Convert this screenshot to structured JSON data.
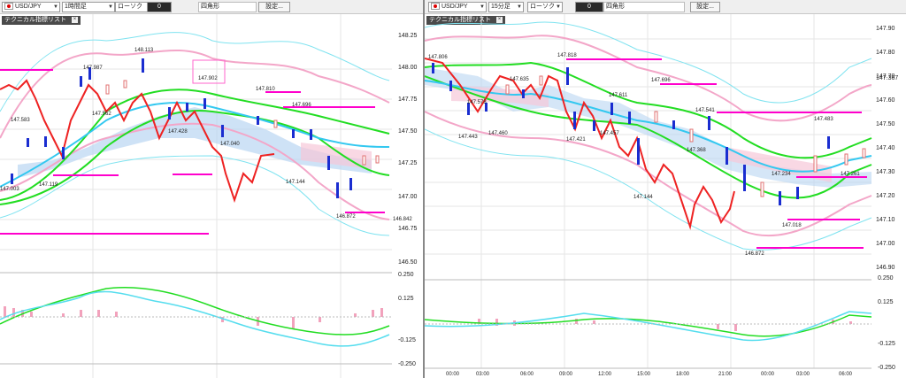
{
  "left_chart": {
    "symbol": "USD/JPY",
    "timeframe": "1時間足",
    "chart_type": "ローソク",
    "selected": "0",
    "shape": "四角形",
    "settings_label": "設定...",
    "tech_list_label": "テクニカル指標リスト",
    "price_ticks": [
      "148.25",
      "148.00",
      "147.75",
      "147.50",
      "147.25",
      "147.00",
      "146.75",
      "146.50"
    ],
    "osc_ticks": [
      "0.250",
      "0.125",
      "-0.125",
      "-0.250"
    ],
    "annotations": [
      "148.113",
      "147.987",
      "147.902",
      "147.583",
      "147.562",
      "147.810",
      "147.696",
      "147.119",
      "147.144",
      "146.842",
      "146.872",
      "147.428",
      "147.040",
      "147.003"
    ]
  },
  "right_chart": {
    "symbol": "USD/JPY",
    "timeframe": "15分足",
    "chart_type": "ローソク",
    "selected": "0",
    "shape": "四角形",
    "settings_label": "設定...",
    "tech_list_label": "テクニカル指標リスト",
    "price_ticks": [
      "147.90",
      "147.80",
      "147.70",
      "147.60",
      "147.50",
      "147.40",
      "147.30",
      "147.20",
      "147.10",
      "147.00",
      "146.90"
    ],
    "current_price": "147.367",
    "osc_ticks": [
      "0.250",
      "0.125",
      "-0.125",
      "-0.250"
    ],
    "time_labels": [
      "00:00",
      "03:00",
      "06:00",
      "09:00",
      "12:00",
      "15:00",
      "18:00",
      "21:00",
      "00:00",
      "03:00",
      "06:00"
    ],
    "annotations": [
      "147.806",
      "147.818",
      "147.696",
      "147.635",
      "147.578",
      "147.443",
      "147.460",
      "147.421",
      "147.457",
      "147.611",
      "147.541",
      "147.483",
      "147.368",
      "147.234",
      "147.261",
      "147.144",
      "147.018",
      "146.872"
    ]
  }
}
